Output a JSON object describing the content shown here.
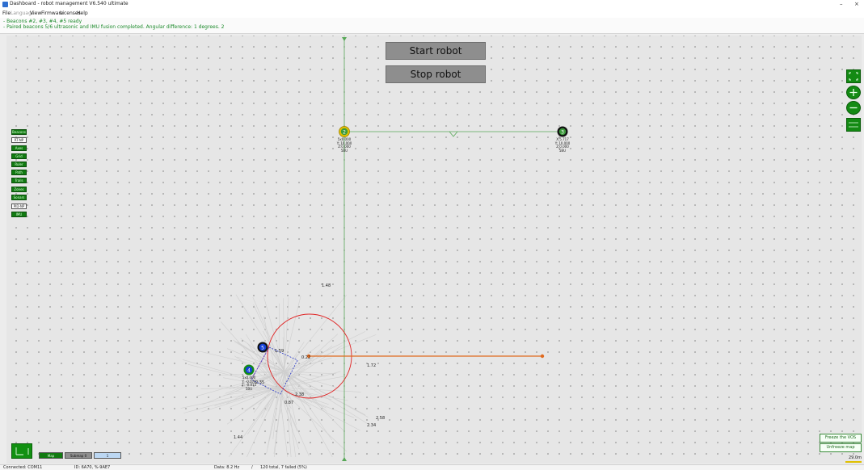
{
  "window": {
    "title": "Dashboard - robot management  V6.540  ultimate",
    "minimize": "–",
    "close": "×"
  },
  "menu": [
    "File",
    "Language",
    "View",
    "Firmware",
    "Licenses",
    "Help"
  ],
  "menu_disabled": [
    "Language"
  ],
  "info": {
    "line1": "- Beacons #2, #3, #4, #5 ready",
    "line2": "- Paired beacons 5/6 ultrasonic and IMU fusion completed. Angular difference: 1 degrees. 2"
  },
  "buttons": {
    "start": "Start robot",
    "stop": "Stop robot"
  },
  "layers": [
    {
      "label": "Beacons",
      "on": true
    },
    {
      "label": "RT-NP",
      "on": false
    },
    {
      "label": "Axes",
      "on": true
    },
    {
      "label": "Grid",
      "on": true
    },
    {
      "label": "Ruler",
      "on": true
    },
    {
      "label": "Path",
      "on": true
    },
    {
      "label": "Trails",
      "on": true
    },
    {
      "label": "Zones",
      "on": true
    },
    {
      "label": "Sonars",
      "on": true
    },
    {
      "label": "PID-NP",
      "on": false
    },
    {
      "label": "IMU",
      "on": true
    }
  ],
  "zoom_controls": [
    "fit-icon",
    "zoom-in-icon",
    "zoom-out-icon",
    "grid-toggle-icon"
  ],
  "beacons": [
    {
      "id": "2",
      "color": "#e4c000",
      "l1": "5x0.000",
      "l2": "Y: 10.000",
      "l3": "Z:0.000",
      "l4": "5BU"
    },
    {
      "id": "3",
      "color": "#111111",
      "l1": "X:5.717",
      "l2": "Y: 10.000",
      "l3": "Z:0.000",
      "l4": "5BU"
    },
    {
      "id": "5",
      "color": "#1540d8",
      "l1": "",
      "l2": "",
      "l3": "",
      "l4": ""
    },
    {
      "id": "4",
      "color": "#138a13",
      "l1": "5x0.000",
      "l2": "Y: -0.076",
      "l3": "Z: -0.015",
      "l4": "5BU"
    }
  ],
  "distance_labels": [
    "1.48",
    "0.22",
    "1.72",
    "1.59",
    "0.87",
    "2.38",
    "2.58",
    "2.34",
    "2.35",
    "1.44"
  ],
  "bottom_left": {
    "mode1": "Map",
    "mode2": "Submap 0",
    "mode3": "1"
  },
  "right_buttons": {
    "freeze": "Freeze the VOS",
    "unfreeze": "Unfreeze map"
  },
  "scale": "29.0m",
  "status": {
    "connection": "Connected: COM11",
    "device": "ID: 6A70, %-9AE7",
    "rate": "Data: 8.2 Hz",
    "slash": "/",
    "stats": "120 total, 7 failed (5%)"
  },
  "colors": {
    "accent_green": "#138a13",
    "path_orange": "#e06a1e",
    "axis_green": "#58a858",
    "range_circle": "#e02020",
    "path_blue": "#2433c8"
  }
}
